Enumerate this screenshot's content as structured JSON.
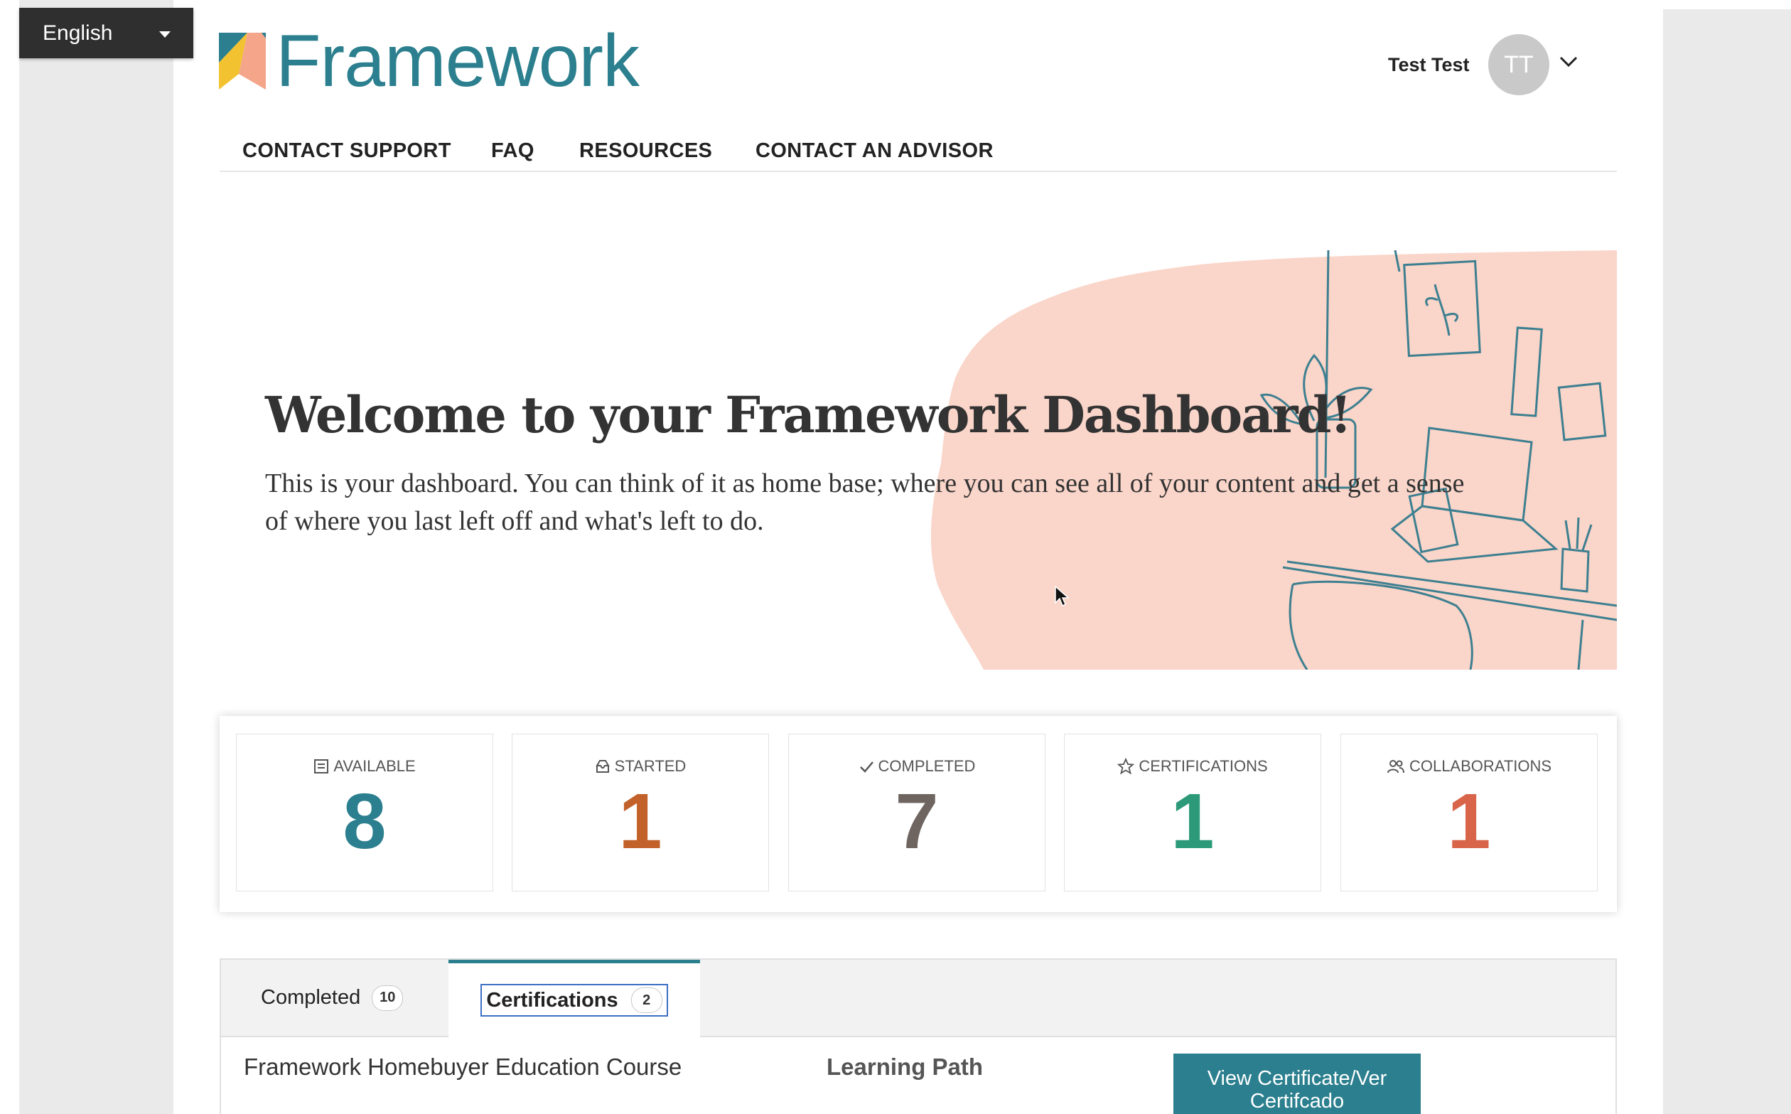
{
  "language": {
    "selected": "English"
  },
  "brand": {
    "name": "Framework"
  },
  "user": {
    "name": "Test Test",
    "initials": "TT"
  },
  "nav": {
    "contact_support": "CONTACT SUPPORT",
    "faq": "FAQ",
    "resources": "RESOURCES",
    "contact_advisor": "CONTACT AN ADVISOR"
  },
  "hero": {
    "title": "Welcome to your Framework Dashboard!",
    "text": "This is your dashboard. You can think of it as home base; where you can see all of your content and get a sense of where you last left off and what's left to do."
  },
  "stats": {
    "available": {
      "label": "Available",
      "value": "8",
      "color": "#2b7f8e",
      "icon": "catalog-icon"
    },
    "started": {
      "label": "Started",
      "value": "1",
      "color": "#c2612a",
      "icon": "inbox-icon"
    },
    "completed": {
      "label": "Completed",
      "value": "7",
      "color": "#6e6560",
      "icon": "check-icon"
    },
    "certifications": {
      "label": "Certifications",
      "value": "1",
      "color": "#2c9a78",
      "icon": "star-icon"
    },
    "collaborations": {
      "label": "Collaborations",
      "value": "1",
      "color": "#d8644a",
      "icon": "people-icon"
    }
  },
  "tabs": {
    "completed": {
      "label": "Completed",
      "count": "10"
    },
    "certifications": {
      "label": "Certifications",
      "count": "2"
    }
  },
  "table": {
    "rows": [
      {
        "title": "Framework Homebuyer Education Course",
        "type": "Learning Path",
        "action": "View Certificate/Ver Certifcado"
      }
    ]
  },
  "colors": {
    "accent": "#2b7f8e",
    "hero_blob": "#fad5c9",
    "dark": "#2f2f2f"
  }
}
